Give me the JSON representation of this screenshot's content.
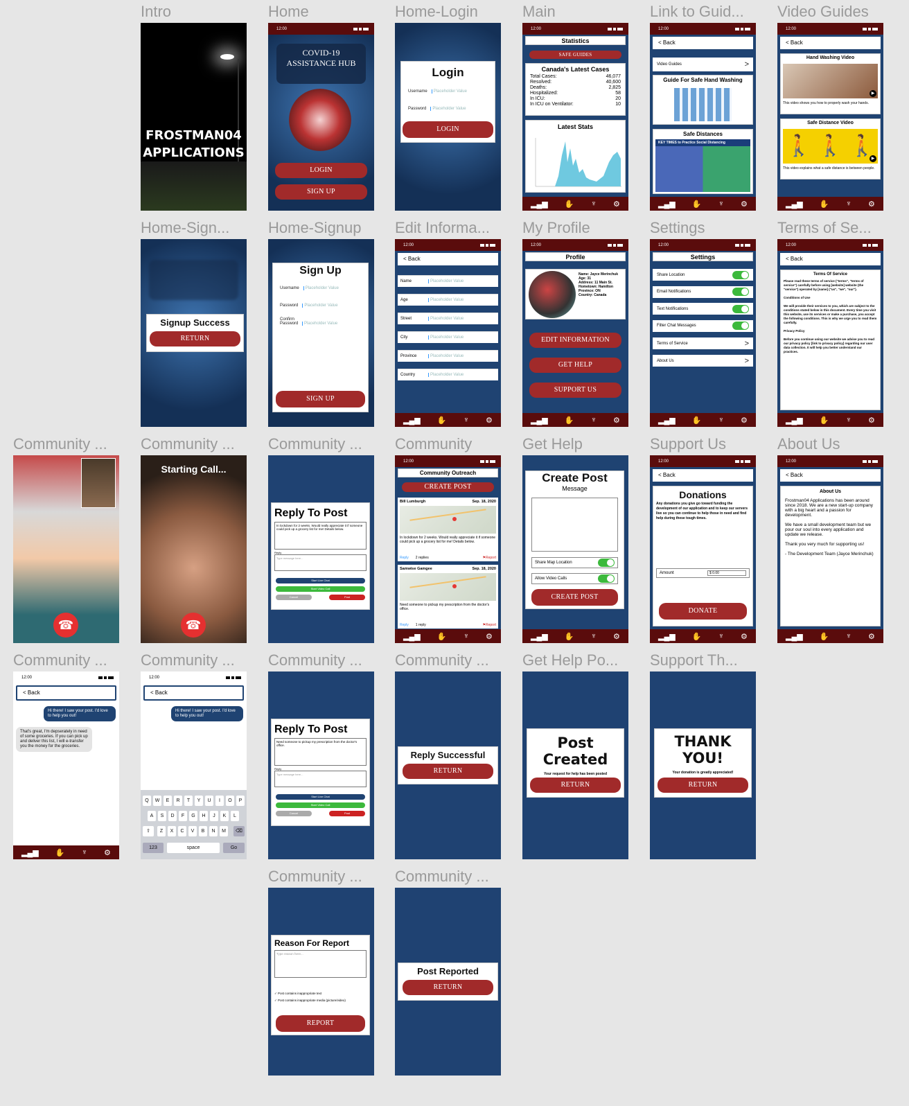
{
  "frames": [
    {
      "title": "Intro"
    },
    {
      "title": "Home"
    },
    {
      "title": "Home-Login"
    },
    {
      "title": "Main"
    },
    {
      "title": "Link to Guid..."
    },
    {
      "title": "Video Guides"
    },
    {
      "title": "Home-Sign..."
    },
    {
      "title": "Home-Signup"
    },
    {
      "title": "Edit Informa..."
    },
    {
      "title": "My Profile"
    },
    {
      "title": "Settings"
    },
    {
      "title": "Terms of Se..."
    },
    {
      "title": "Community ..."
    },
    {
      "title": "Community ..."
    },
    {
      "title": "Community ..."
    },
    {
      "title": "Community"
    },
    {
      "title": "Get Help"
    },
    {
      "title": "Support Us"
    },
    {
      "title": "About Us"
    },
    {
      "title": "Community ..."
    },
    {
      "title": "Community ..."
    },
    {
      "title": "Community ..."
    },
    {
      "title": "Community ..."
    },
    {
      "title": "Get Help Po..."
    },
    {
      "title": "Support Th..."
    },
    {
      "title": "Community ..."
    },
    {
      "title": "Community ..."
    }
  ],
  "status": {
    "time": "12:00"
  },
  "intro": {
    "line1": "FROSTMAN04",
    "line2": "APPLICATIONS"
  },
  "home": {
    "hub": "COVID-19 ASSISTANCE HUB",
    "login": "LOGIN",
    "signup": "SIGN UP"
  },
  "login": {
    "title": "Login",
    "username": "Username",
    "password": "Password",
    "placeholder": "Placeholder Value",
    "button": "LOGIN"
  },
  "main": {
    "statistics": "Statistics",
    "safe_guides": "SAFE GUIDES",
    "latest_cases_title": "Canada's Latest Cases",
    "cases": [
      {
        "label": "Total Cases:",
        "value": "46,077"
      },
      {
        "label": "Resolved:",
        "value": "40,600"
      },
      {
        "label": "Deaths:",
        "value": "2,825"
      },
      {
        "label": "Hospitalized:",
        "value": "58"
      },
      {
        "label": "In ICU:",
        "value": "20"
      },
      {
        "label": "In ICU on Ventilator:",
        "value": "10"
      }
    ],
    "latest_stats": "Latest Stats"
  },
  "links": {
    "back": "Back",
    "video_guides": "Video Guides",
    "hand_guide": "Guide For Safe Hand Washing",
    "safe_dist": "Safe Distances",
    "key_times": "KEY TIMES to Practice Social Distancing"
  },
  "videos": {
    "back": "Back",
    "hand_title": "Hand Washing Video",
    "hand_desc": "This video shows you how to properly wash your hands.",
    "dist_title": "Safe Distance Video",
    "dist_desc": "This video explains what a safe distance is between people."
  },
  "signup_success": {
    "title": "Signup Success",
    "button": "RETURN"
  },
  "signup": {
    "title": "Sign Up",
    "username": "Username",
    "password": "Password",
    "confirm": "Confirm Password",
    "placeholder": "Placeholder Value",
    "button": "SIGN UP"
  },
  "edit": {
    "back": "Back",
    "fields": [
      "Name",
      "Age",
      "Street",
      "City",
      "Province",
      "Country"
    ],
    "placeholder": "Placeholder Value"
  },
  "profile": {
    "title": "Profile",
    "name": "Name: Jayce Merinchuk",
    "age": "Age: 31",
    "address": "Address: 11 Main St.",
    "hometown": "Hometown: Hamilton",
    "province": "Province: ON",
    "country": "Country: Canada",
    "edit": "EDIT INFORMATION",
    "help": "GET HELP",
    "support": "SUPPORT US"
  },
  "settings": {
    "title": "Settings",
    "toggles": [
      "Share Location",
      "Email Notifications",
      "Text Notifications",
      "Filter Chat Messages"
    ],
    "links": [
      "Terms of Service",
      "About Us"
    ]
  },
  "terms": {
    "back": "Back",
    "title": "Terms Of Service",
    "p1": "Please read these terms of service (\"terms\", \"terms of service\") carefully before using [website] website (the \"service\") operated by [name] (\"us\", \"we\", \"our\").",
    "h2": "Conditions of Use",
    "p2": "We will provide their services to you, which are subject to the conditions stated below in this document. Every time you visit this website, use its services or make a purchase, you accept the following conditions. This is why we urge you to read them carefully.",
    "h3": "Privacy Policy",
    "p3": "Before you continue using our website we advise you to read our privacy policy [link to privacy policy] regarding our user data collection. It will help you better understand our practices."
  },
  "call": {
    "starting": "Starting Call..."
  },
  "reply": {
    "title": "Reply To Post",
    "post1": "In lockdown for 2 weeks. Would really appreciate it if someone could pick up a grocery list for me! Details below.",
    "post2": "Need someone to pickup my prescription from the doctor's office.",
    "reply_label": "Reply",
    "type_msg": "Type message here...",
    "live_chat": "Start Live Chat",
    "video_call": "Start Video Call",
    "cancel": "Cancel",
    "post": "Post"
  },
  "community": {
    "title": "Community Outreach",
    "create": "CREATE POST",
    "posts": [
      {
        "name": "Bill Lumburgh",
        "date": "Sep. 18, 2020",
        "text": "In lockdown for 2 weeks. Would really appreciate it if someone could pick up a grocery list for me! Details below.",
        "reply": "Reply",
        "count": "2 replies",
        "report": "Report"
      },
      {
        "name": "Samwise Gamgee",
        "date": "Sep. 18, 2020",
        "text": "Need someone to pickup my prescription from the doctor's office.",
        "reply": "Reply",
        "count": "1 reply",
        "report": "Report"
      }
    ]
  },
  "gethelp": {
    "title": "Create Post",
    "sub": "Message",
    "share_map": "Share Map Location",
    "allow_video": "Allow Video Calls",
    "button": "CREATE POST"
  },
  "support": {
    "back": "Back",
    "title": "Donations",
    "text": "Any donations you give go toward funding the development of our application and to keep our servers live so you can continue to help those in need and find help during these tough times.",
    "amount": "Amount",
    "amount_val": "$ 0.00",
    "button": "DONATE"
  },
  "about": {
    "back": "Back",
    "title": "About Us",
    "p1": "Frostman04 Applications has been around since 2018. We are a new start-up company with a big heart and a passion for development.",
    "p2": "We have a small development team but we pour our soul into every application and update we release.",
    "p3": "Thank you very much for supporting us!",
    "p4": "- The Development Team (Jayce Merinchuk)"
  },
  "chat": {
    "back": "Back",
    "msg1": "Hi there! I saw your post. I'd love to help you out!",
    "msg2": "That's great, I'm depserately in need of some groceries. If you can pick up and deliver this list, I will e-transfer you the money for the groceries."
  },
  "keyboard": {
    "row1": [
      "Q",
      "W",
      "E",
      "R",
      "T",
      "Y",
      "U",
      "I",
      "O",
      "P"
    ],
    "row2": [
      "A",
      "S",
      "D",
      "F",
      "G",
      "H",
      "J",
      "K",
      "L"
    ],
    "row3": [
      "Z",
      "X",
      "C",
      "V",
      "B",
      "N",
      "M"
    ],
    "num": "123",
    "space": "space",
    "go": "Go"
  },
  "reply_success": {
    "title": "Reply Successful",
    "button": "RETURN"
  },
  "post_created": {
    "title": "Post Created",
    "sub": "Your request for help has been posted",
    "button": "RETURN"
  },
  "thank_you": {
    "title": "THANK YOU!",
    "sub": "Your donation is greatly appreciated!",
    "button": "RETURN"
  },
  "report": {
    "title": "Reason For Report",
    "placeholder": "Type reason here...",
    "opt1": "Post contains inappropriate text",
    "opt2": "Post contains inappropriate media (picture/video)",
    "button": "REPORT"
  },
  "reported": {
    "title": "Post Reported",
    "button": "RETURN"
  },
  "colors": {
    "navy": "#1f4372",
    "maroon": "#5a0c0c",
    "red": "#a12a2a",
    "green": "#3cb93c"
  }
}
